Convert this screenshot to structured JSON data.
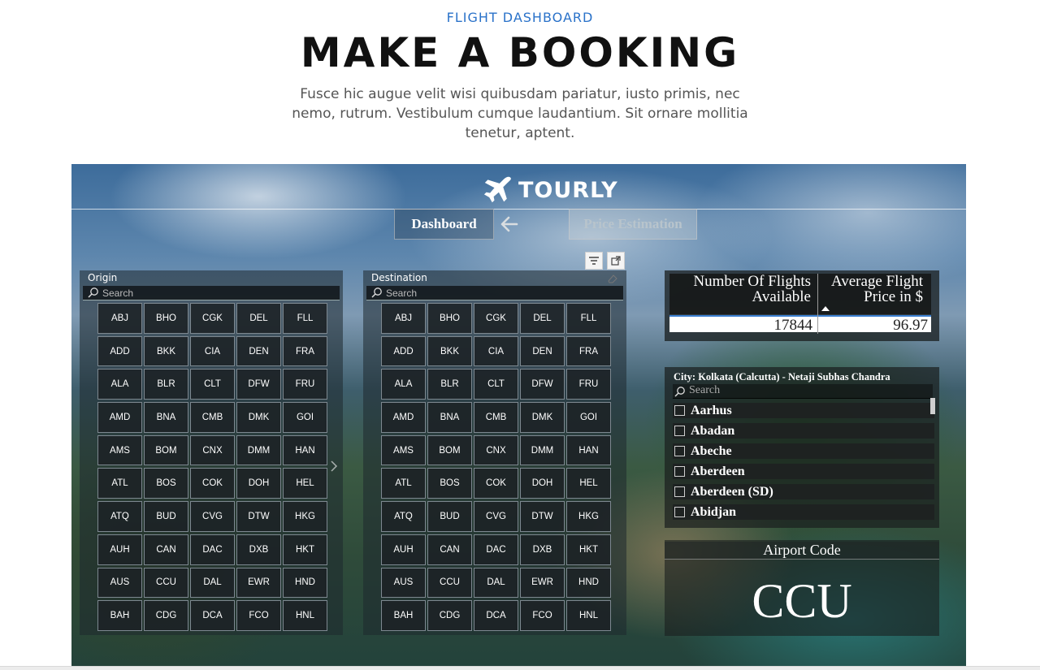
{
  "header": {
    "eyebrow": "FLIGHT DASHBOARD",
    "title": "MAKE A BOOKING",
    "subtitle": "Fusce hic augue velit wisi quibusdam pariatur, iusto primis, nec nemo, rutrum. Vestibulum cumque laudantium. Sit ornare mollitia tenetur, aptent."
  },
  "report": {
    "logo_text": "TOURLY",
    "logo_icon": "airplane-icon",
    "nav": {
      "dashboard_label": "Dashboard",
      "price_label": "Price Estimation",
      "back_icon": "arrow-left-icon"
    },
    "toolbar_icons": [
      "filter-icon",
      "focus-mode-icon"
    ],
    "origin": {
      "label": "Origin",
      "search_placeholder": "Search",
      "codes": [
        "ABJ",
        "BHO",
        "CGK",
        "DEL",
        "FLL",
        "ADD",
        "BKK",
        "CIA",
        "DEN",
        "FRA",
        "ALA",
        "BLR",
        "CLT",
        "DFW",
        "FRU",
        "AMD",
        "BNA",
        "CMB",
        "DMK",
        "GOI",
        "AMS",
        "BOM",
        "CNX",
        "DMM",
        "HAN",
        "ATL",
        "BOS",
        "COK",
        "DOH",
        "HEL",
        "ATQ",
        "BUD",
        "CVG",
        "DTW",
        "HKG",
        "AUH",
        "CAN",
        "DAC",
        "DXB",
        "HKT",
        "AUS",
        "CCU",
        "DAL",
        "EWR",
        "HND",
        "BAH",
        "CDG",
        "DCA",
        "FCO",
        "HNL"
      ]
    },
    "destination": {
      "label": "Destination",
      "search_placeholder": "Search",
      "codes": [
        "ABJ",
        "BHO",
        "CGK",
        "DEL",
        "FLL",
        "ADD",
        "BKK",
        "CIA",
        "DEN",
        "FRA",
        "ALA",
        "BLR",
        "CLT",
        "DFW",
        "FRU",
        "AMD",
        "BNA",
        "CMB",
        "DMK",
        "GOI",
        "AMS",
        "BOM",
        "CNX",
        "DMM",
        "HAN",
        "ATL",
        "BOS",
        "COK",
        "DOH",
        "HEL",
        "ATQ",
        "BUD",
        "CVG",
        "DTW",
        "HKG",
        "AUH",
        "CAN",
        "DAC",
        "DXB",
        "HKT",
        "AUS",
        "CCU",
        "DAL",
        "EWR",
        "HND",
        "BAH",
        "CDG",
        "DCA",
        "FCO",
        "HNL"
      ]
    },
    "kpi": {
      "flights_header": "Number Of Flights Available",
      "price_header": "Average Flight Price in $",
      "flights_value": "17844",
      "price_value": "96.97"
    },
    "city": {
      "label": "City: Kolkata (Calcutta) - Netaji Subhas Chandra",
      "search_placeholder": "Search",
      "items": [
        "Aarhus",
        "Abadan",
        "Abeche",
        "Aberdeen",
        "Aberdeen (SD)",
        "Abidjan"
      ]
    },
    "airport": {
      "label": "Airport Code",
      "value": "CCU"
    }
  },
  "colors": {
    "accent": "#2a72c9",
    "title": "#111111",
    "kpi_underline": "#3b7fd0"
  }
}
